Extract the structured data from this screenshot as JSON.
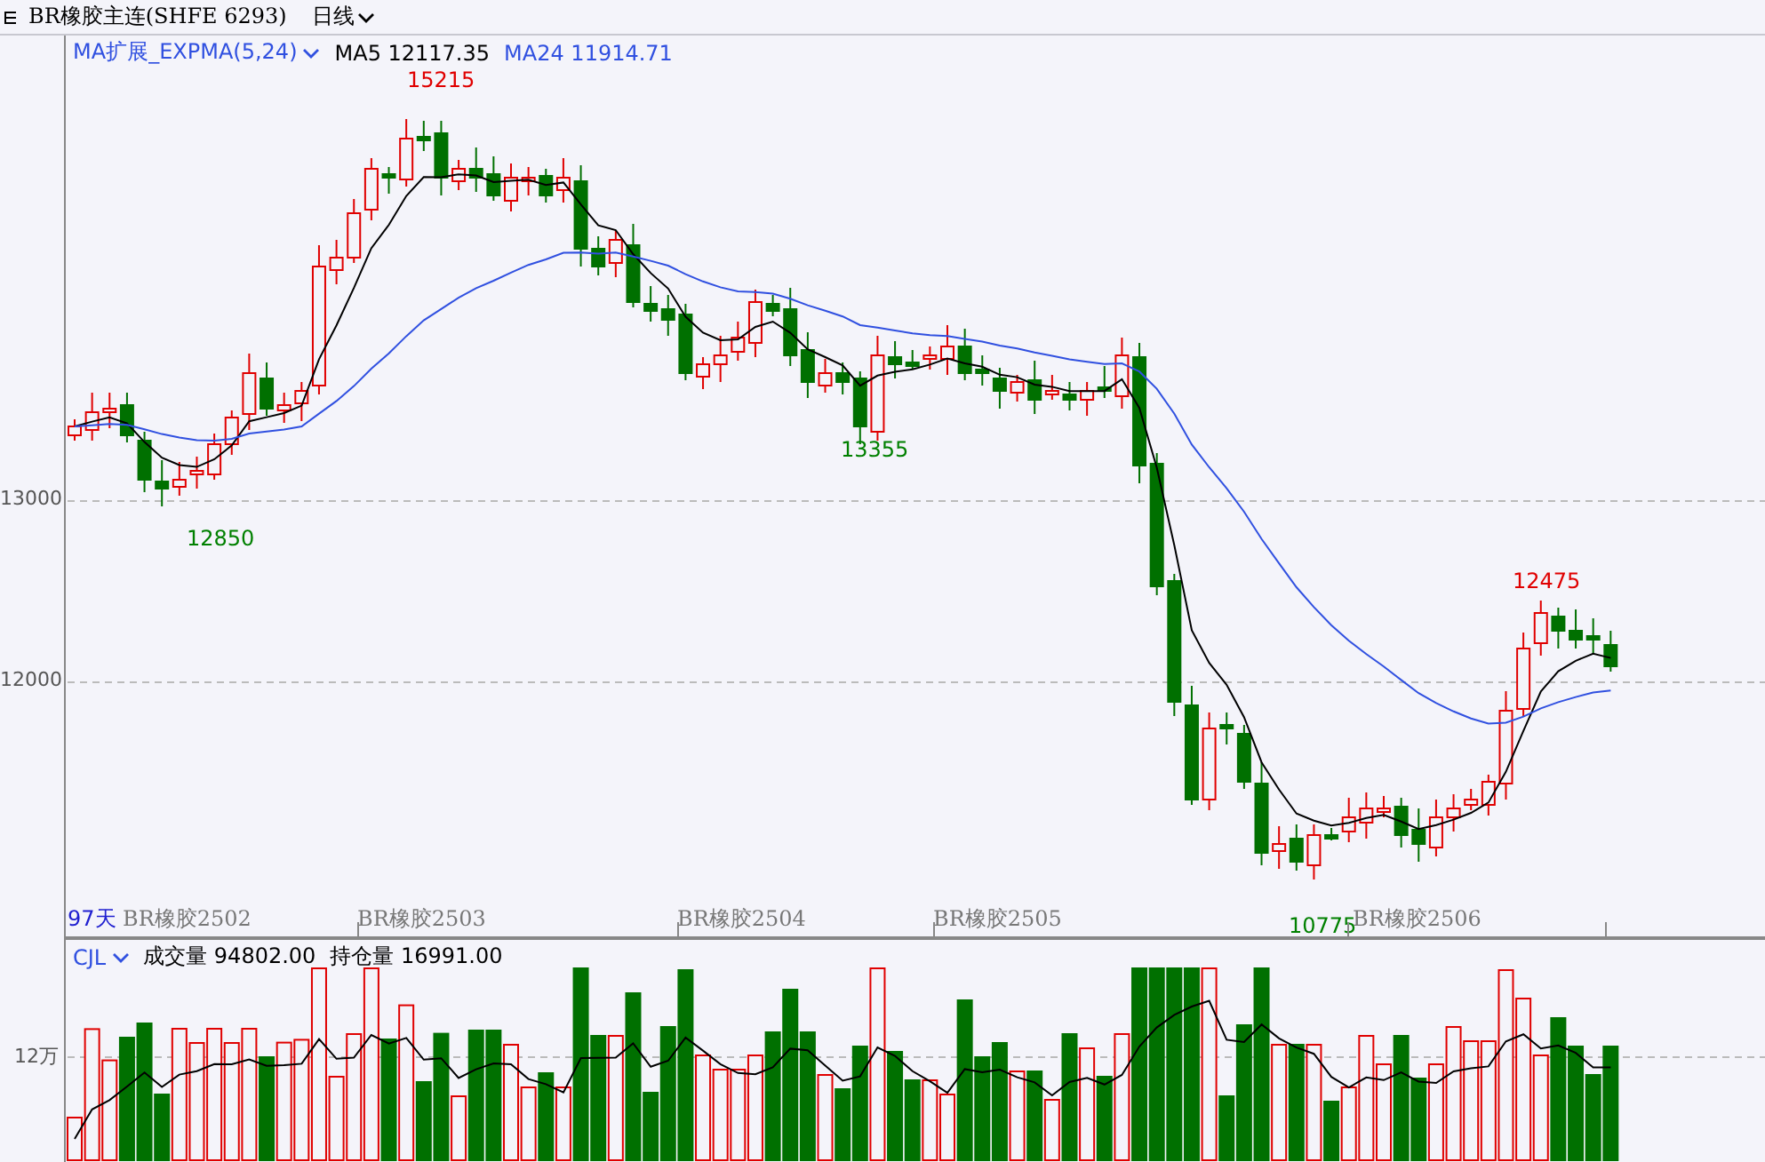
{
  "header": {
    "symbol": "BR橡胶主连(SHFE 6293)",
    "period": "日线"
  },
  "main_panel": {
    "indicator": "MA扩展_EXPMA(5,24)",
    "readouts": [
      {
        "label": "MA5",
        "value": "12117.35",
        "color": "#000000"
      },
      {
        "label": "MA24",
        "value": "11914.71",
        "color": "#3050e0"
      }
    ],
    "y_labels": [
      "13000",
      "12000"
    ],
    "price_marks": [
      {
        "text": "15215",
        "color": "#e00000"
      },
      {
        "text": "12850",
        "color": "#008000"
      },
      {
        "text": "13355",
        "color": "#008000"
      },
      {
        "text": "10775",
        "color": "#008000"
      },
      {
        "text": "12475",
        "color": "#e00000"
      }
    ],
    "span_label": "97天",
    "contract_labels": [
      "BR橡胶2502",
      "BR橡胶2503",
      "BR橡胶2504",
      "BR橡胶2505",
      "BR橡胶2506"
    ]
  },
  "volume_panel": {
    "indicator": "CJL",
    "readouts": [
      {
        "label": "成交量",
        "value": "94802.00"
      },
      {
        "label": "持仓量",
        "value": "16991.00"
      }
    ],
    "y_labels": [
      "12万"
    ]
  }
}
